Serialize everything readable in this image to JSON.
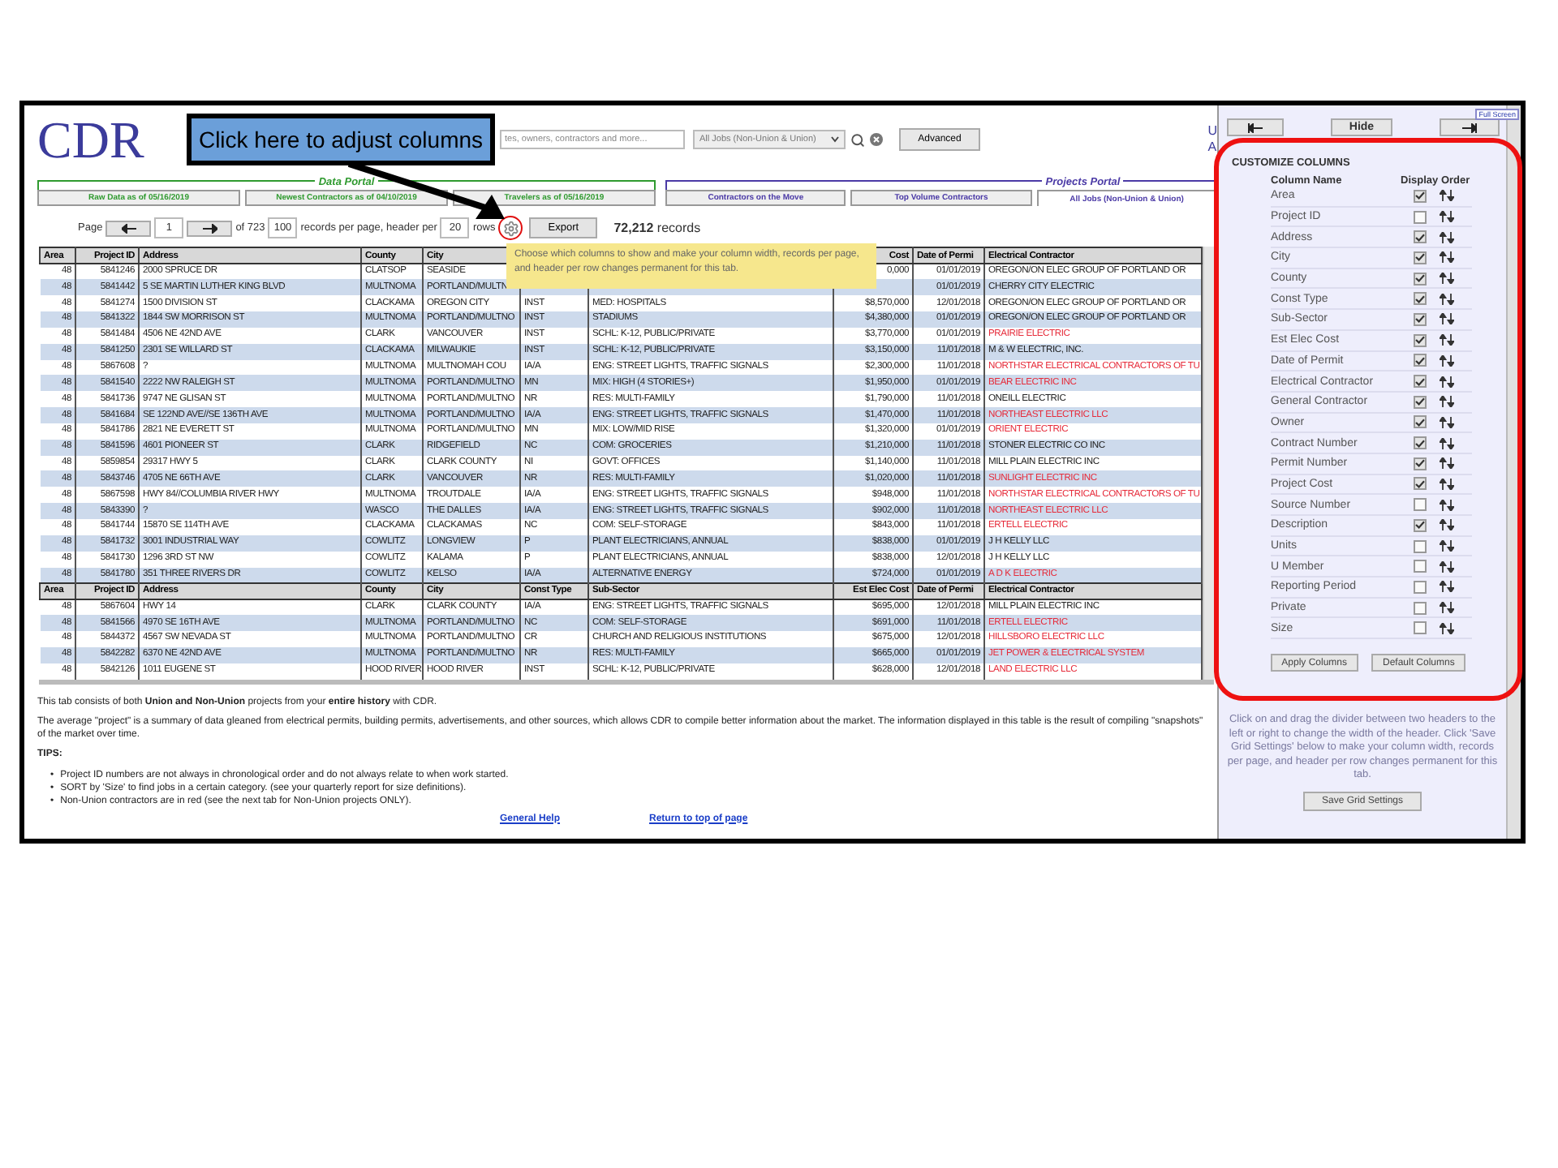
{
  "header": {
    "logo": "CDR",
    "search": {
      "placeholder": "tes, owners, contractors and more..."
    },
    "job_filter": "All Jobs (Non-Union & Union)",
    "advanced_button": "Advanced",
    "cut_labels": [
      "U",
      "A"
    ]
  },
  "callout": {
    "text": "Click here to adjust columns"
  },
  "portals": [
    {
      "title": "Data Portal",
      "color": "#2f9a2f",
      "tabs": [
        {
          "label": "Raw Data as of 05/16/2019",
          "selected": false
        },
        {
          "label": "Newest Contractors as of 04/10/2019",
          "selected": false
        },
        {
          "label": "Travelers as of 05/16/2019",
          "selected": false
        }
      ]
    },
    {
      "title": "Projects Portal",
      "color": "#4b3aa6",
      "tabs": [
        {
          "label": "Contractors on the Move",
          "selected": false
        },
        {
          "label": "Top Volume Contractors",
          "selected": false
        },
        {
          "label": "All Jobs (Non-Union & Union)",
          "selected": true
        }
      ]
    }
  ],
  "pager": {
    "page_label": "Page",
    "page": "1",
    "of_label": "of 723",
    "per_page": "100",
    "per_page_label": "records per page, header per",
    "header_per": "20",
    "rows_label": "rows",
    "export_button": "Export",
    "records_count": "72,212",
    "records_label": "records"
  },
  "tooltip": "Choose which columns to show and make your column width, records per page, and header per row changes permanent for this tab.",
  "table": {
    "rows": [
      {
        "kind": "header",
        "cells": [
          "Area",
          "Project ID",
          "Address",
          "County",
          "City",
          null,
          null,
          "Cost",
          "Date of Permi",
          "Electrical Contractor"
        ]
      },
      {
        "kind": "data",
        "non_union": false,
        "cells": [
          "48",
          "5841246",
          "2000 SPRUCE DR",
          "CLATSOP",
          "SEASIDE",
          null,
          null,
          "0,000",
          "01/01/2019",
          "OREGON/ON ELEC GROUP OF PORTLAND OR"
        ]
      },
      {
        "kind": "data",
        "non_union": false,
        "cells": [
          "48",
          "5841442",
          "5 SE MARTIN LUTHER KING BLVD",
          "MULTNOMA",
          "PORTLAND/MULTN",
          null,
          null,
          null,
          "01/01/2019",
          "CHERRY CITY ELECTRIC"
        ]
      },
      {
        "kind": "data",
        "non_union": false,
        "cells": [
          "48",
          "5841274",
          "1500 DIVISION ST",
          "CLACKAMA",
          "OREGON CITY",
          "INST",
          "MED: HOSPITALS",
          "$8,570,000",
          "12/01/2018",
          "OREGON/ON ELEC GROUP OF PORTLAND OR"
        ]
      },
      {
        "kind": "data",
        "non_union": false,
        "cells": [
          "48",
          "5841322",
          "1844 SW MORRISON ST",
          "MULTNOMA",
          "PORTLAND/MULTNO",
          "INST",
          "STADIUMS",
          "$4,380,000",
          "01/01/2019",
          "OREGON/ON ELEC GROUP OF PORTLAND OR"
        ]
      },
      {
        "kind": "data",
        "non_union": true,
        "cells": [
          "48",
          "5841484",
          "4506 NE 42ND AVE",
          "CLARK",
          "VANCOUVER",
          "INST",
          "SCHL: K-12, PUBLIC/PRIVATE",
          "$3,770,000",
          "01/01/2019",
          "PRAIRIE ELECTRIC"
        ]
      },
      {
        "kind": "data",
        "non_union": false,
        "cells": [
          "48",
          "5841250",
          "2301 SE WILLARD ST",
          "CLACKAMA",
          "MILWAUKIE",
          "INST",
          "SCHL: K-12, PUBLIC/PRIVATE",
          "$3,150,000",
          "11/01/2018",
          "M & W ELECTRIC, INC."
        ]
      },
      {
        "kind": "data",
        "non_union": true,
        "cells": [
          "48",
          "5867608",
          "?",
          "MULTNOMA",
          "MULTNOMAH COU",
          "IA/A",
          "ENG: STREET LIGHTS, TRAFFIC SIGNALS",
          "$2,300,000",
          "11/01/2018",
          "NORTHSTAR ELECTRICAL CONTRACTORS OF TU"
        ]
      },
      {
        "kind": "data",
        "non_union": true,
        "cells": [
          "48",
          "5841540",
          "2222 NW RALEIGH ST",
          "MULTNOMA",
          "PORTLAND/MULTNO",
          "MN",
          "MIX: HIGH (4 STORIES+)",
          "$1,950,000",
          "01/01/2019",
          "BEAR ELECTRIC INC"
        ]
      },
      {
        "kind": "data",
        "non_union": false,
        "cells": [
          "48",
          "5841736",
          "9747 NE GLISAN ST",
          "MULTNOMA",
          "PORTLAND/MULTNO",
          "NR",
          "RES: MULTI-FAMILY",
          "$1,790,000",
          "11/01/2018",
          "ONEILL ELECTRIC"
        ]
      },
      {
        "kind": "data",
        "non_union": true,
        "cells": [
          "48",
          "5841684",
          "SE 122ND AVE//SE 136TH AVE",
          "MULTNOMA",
          "PORTLAND/MULTNO",
          "IA/A",
          "ENG: STREET LIGHTS, TRAFFIC SIGNALS",
          "$1,470,000",
          "11/01/2018",
          "NORTHEAST ELECTRIC LLC"
        ]
      },
      {
        "kind": "data",
        "non_union": true,
        "cells": [
          "48",
          "5841786",
          "2821 NE EVERETT ST",
          "MULTNOMA",
          "PORTLAND/MULTNO",
          "MN",
          "MIX: LOW/MID RISE",
          "$1,320,000",
          "01/01/2019",
          "ORIENT ELECTRIC"
        ]
      },
      {
        "kind": "data",
        "non_union": false,
        "cells": [
          "48",
          "5841596",
          "4601 PIONEER ST",
          "CLARK",
          "RIDGEFIELD",
          "NC",
          "COM: GROCERIES",
          "$1,210,000",
          "11/01/2018",
          "STONER ELECTRIC CO INC"
        ]
      },
      {
        "kind": "data",
        "non_union": false,
        "cells": [
          "48",
          "5859854",
          "29317 HWY 5",
          "CLARK",
          "CLARK COUNTY",
          "NI",
          "GOVT: OFFICES",
          "$1,140,000",
          "11/01/2018",
          "MILL PLAIN ELECTRIC INC"
        ]
      },
      {
        "kind": "data",
        "non_union": true,
        "cells": [
          "48",
          "5843746",
          "4705 NE 66TH AVE",
          "CLARK",
          "VANCOUVER",
          "NR",
          "RES: MULTI-FAMILY",
          "$1,020,000",
          "11/01/2018",
          "SUNLIGHT ELECTRIC INC"
        ]
      },
      {
        "kind": "data",
        "non_union": true,
        "cells": [
          "48",
          "5867598",
          "HWY 84//COLUMBIA RIVER HWY",
          "MULTNOMA",
          "TROUTDALE",
          "IA/A",
          "ENG: STREET LIGHTS, TRAFFIC SIGNALS",
          "$948,000",
          "11/01/2018",
          "NORTHSTAR ELECTRICAL CONTRACTORS OF TU"
        ]
      },
      {
        "kind": "data",
        "non_union": true,
        "cells": [
          "48",
          "5843390",
          "?",
          "WASCO",
          "THE DALLES",
          "IA/A",
          "ENG: STREET LIGHTS, TRAFFIC SIGNALS",
          "$902,000",
          "11/01/2018",
          "NORTHEAST ELECTRIC LLC"
        ]
      },
      {
        "kind": "data",
        "non_union": true,
        "cells": [
          "48",
          "5841744",
          "15870 SE 114TH AVE",
          "CLACKAMA",
          "CLACKAMAS",
          "NC",
          "COM: SELF-STORAGE",
          "$843,000",
          "11/01/2018",
          "ERTELL ELECTRIC"
        ]
      },
      {
        "kind": "data",
        "non_union": false,
        "cells": [
          "48",
          "5841732",
          "3001 INDUSTRIAL WAY",
          "COWLITZ",
          "LONGVIEW",
          "P",
          "PLANT ELECTRICIANS, ANNUAL",
          "$838,000",
          "01/01/2019",
          "J H KELLY LLC"
        ]
      },
      {
        "kind": "data",
        "non_union": false,
        "cells": [
          "48",
          "5841730",
          "1296 3RD ST NW",
          "COWLITZ",
          "KALAMA",
          "P",
          "PLANT ELECTRICIANS, ANNUAL",
          "$838,000",
          "12/01/2018",
          "J H KELLY LLC"
        ]
      },
      {
        "kind": "data",
        "non_union": true,
        "cells": [
          "48",
          "5841780",
          "351 THREE RIVERS DR",
          "COWLITZ",
          "KELSO",
          "IA/A",
          "ALTERNATIVE ENERGY",
          "$724,000",
          "01/01/2019",
          "A D K ELECTRIC"
        ]
      },
      {
        "kind": "header",
        "cells": [
          "Area",
          "Project ID",
          "Address",
          "County",
          "City",
          "Const Type",
          "Sub-Sector",
          "Est Elec Cost",
          "Date of Permi",
          "Electrical Contractor"
        ]
      },
      {
        "kind": "data",
        "non_union": false,
        "cells": [
          "48",
          "5867604",
          "HWY 14",
          "CLARK",
          "CLARK COUNTY",
          "IA/A",
          "ENG: STREET LIGHTS, TRAFFIC SIGNALS",
          "$695,000",
          "12/01/2018",
          "MILL PLAIN ELECTRIC INC"
        ]
      },
      {
        "kind": "data",
        "non_union": true,
        "cells": [
          "48",
          "5841566",
          "4970 SE 16TH AVE",
          "MULTNOMA",
          "PORTLAND/MULTNO",
          "NC",
          "COM: SELF-STORAGE",
          "$691,000",
          "11/01/2018",
          "ERTELL ELECTRIC"
        ]
      },
      {
        "kind": "data",
        "non_union": true,
        "cells": [
          "48",
          "5844372",
          "4567 SW NEVADA ST",
          "MULTNOMA",
          "PORTLAND/MULTNO",
          "CR",
          "CHURCH AND RELIGIOUS INSTITUTIONS",
          "$675,000",
          "12/01/2018",
          "HILLSBORO ELECTRIC LLC"
        ]
      },
      {
        "kind": "data",
        "non_union": true,
        "cells": [
          "48",
          "5842282",
          "6370 NE 42ND AVE",
          "MULTNOMA",
          "PORTLAND/MULTNO",
          "NR",
          "RES: MULTI-FAMILY",
          "$665,000",
          "01/01/2019",
          "JET POWER & ELECTRICAL SYSTEM"
        ]
      },
      {
        "kind": "data",
        "non_union": true,
        "cells": [
          "48",
          "5842126",
          "1011 EUGENE ST",
          "HOOD RIVER",
          "HOOD RIVER",
          "INST",
          "SCHL: K-12, PUBLIC/PRIVATE",
          "$628,000",
          "12/01/2018",
          "LAND ELECTRIC LLC"
        ]
      }
    ]
  },
  "notes": {
    "paragraphs": [
      "This tab consists of both **Union and Non-Union** projects from your **entire history** with CDR.",
      "The average \"project\" is a summary of data gleaned from electrical permits, building permits, advertisements, and other sources, which allows CDR to compile better information about the market. The information displayed in this table is the result of compiling \"snapshots\" of the market over time."
    ],
    "tips_title": "TIPS:",
    "tips": [
      {
        "bullet": "•",
        "text": "Project ID numbers are not always in chronological order and do not always relate to when work started."
      },
      {
        "bullet": "•",
        "text": "SORT by 'Size' to find jobs in a certain category. (see your quarterly report for size definitions)."
      },
      {
        "bullet": "•",
        "text": "Non-Union contractors are in red (see the next tab for Non-Union projects ONLY)."
      }
    ],
    "links": [
      "General Help",
      "Return to top of page"
    ]
  },
  "side_panel": {
    "full_screen": "Full Screen",
    "hide_button": "Hide",
    "title": "CUSTOMIZE COLUMNS",
    "name_heading": "Column Name",
    "display_heading": "Display",
    "order_heading": "Order",
    "columns": [
      {
        "name": "Area",
        "checked": true
      },
      {
        "name": "Project ID",
        "checked": false
      },
      {
        "name": "Address",
        "checked": true
      },
      {
        "name": "City",
        "checked": true
      },
      {
        "name": "County",
        "checked": true
      },
      {
        "name": "Const Type",
        "checked": true
      },
      {
        "name": "Sub-Sector",
        "checked": true
      },
      {
        "name": "Est Elec Cost",
        "checked": true
      },
      {
        "name": "Date of Permit",
        "checked": true
      },
      {
        "name": "Electrical Contractor",
        "checked": true
      },
      {
        "name": "General Contractor",
        "checked": true
      },
      {
        "name": "Owner",
        "checked": true
      },
      {
        "name": "Contract Number",
        "checked": true
      },
      {
        "name": "Permit Number",
        "checked": true
      },
      {
        "name": "Project Cost",
        "checked": true
      },
      {
        "name": "Source Number",
        "checked": false
      },
      {
        "name": "Description",
        "checked": true
      },
      {
        "name": "Units",
        "checked": false
      },
      {
        "name": "U Member",
        "checked": false
      },
      {
        "name": "Reporting Period",
        "checked": false
      },
      {
        "name": "Private",
        "checked": false
      },
      {
        "name": "Size",
        "checked": false
      }
    ],
    "apply_button": "Apply Columns",
    "default_button": "Default Columns",
    "help": "Click on and drag the divider between two headers to the left or right to change the width of the header. Click 'Save Grid Settings' below to make your column width, records per page, and header per row changes permanent for this tab.",
    "save_button": "Save Grid Settings"
  }
}
